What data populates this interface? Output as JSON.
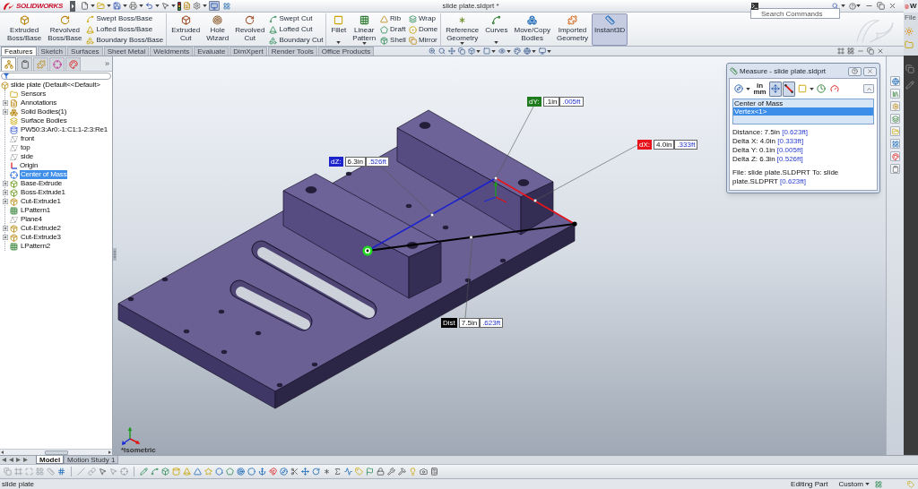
{
  "title_bar": {
    "logo": "SOLIDWORKS",
    "title": "slide plate.sldprt *",
    "search": {
      "placeholder": "Search Commands"
    },
    "quick_access_toggles": [
      {
        "on": true
      },
      {
        "on": false
      }
    ]
  },
  "ribbon": {
    "sections": [
      [
        {
          "kind": "large",
          "label": "Extruded Boss/Base",
          "on": false,
          "dropdown": false
        },
        {
          "kind": "large",
          "label": "Revolved Boss/Base",
          "on": false,
          "dropdown": false
        },
        {
          "kind": "stack",
          "items": [
            "Swept Boss/Base",
            "Lofted Boss/Base",
            "Boundary Boss/Base"
          ]
        }
      ],
      [
        {
          "kind": "large",
          "label": "Extruded Cut",
          "on": false,
          "dropdown": false
        },
        {
          "kind": "large",
          "label": "Hole Wizard",
          "on": false,
          "dropdown": false
        },
        {
          "kind": "large",
          "label": "Revolved Cut",
          "on": false,
          "dropdown": false
        },
        {
          "kind": "stack",
          "items": [
            "Swept Cut",
            "Lofted Cut",
            "Boundary Cut"
          ]
        }
      ],
      [
        {
          "kind": "large",
          "label": "Fillet",
          "on": false,
          "dropdown": true
        },
        {
          "kind": "large",
          "label": "Linear Pattern",
          "on": false,
          "dropdown": true
        },
        {
          "kind": "stack",
          "items": [
            "Rib",
            "Draft",
            "Shell"
          ]
        },
        {
          "kind": "stack",
          "items": [
            "Wrap",
            "Dome",
            "Mirror"
          ]
        }
      ],
      [
        {
          "kind": "large",
          "label": "Reference Geometry",
          "on": false,
          "dropdown": true
        },
        {
          "kind": "large",
          "label": "Curves",
          "on": false,
          "dropdown": true
        },
        {
          "kind": "large",
          "label": "Move/Copy Bodies",
          "on": false,
          "dropdown": false
        },
        {
          "kind": "large",
          "label": "Imported Geometry",
          "on": false,
          "dropdown": false
        },
        {
          "kind": "large",
          "label": "Instant3D",
          "on": true,
          "dropdown": false
        }
      ]
    ]
  },
  "tabs": [
    {
      "label": "Features",
      "selected": true
    },
    {
      "label": "Sketch",
      "selected": false
    },
    {
      "label": "Surfaces",
      "selected": false
    },
    {
      "label": "Sheet Metal",
      "selected": false
    },
    {
      "label": "Weldments",
      "selected": false
    },
    {
      "label": "Evaluate",
      "selected": false
    },
    {
      "label": "DimXpert",
      "selected": false
    },
    {
      "label": "Render Tools",
      "selected": false
    },
    {
      "label": "Office Products",
      "selected": false
    }
  ],
  "feature_tree": {
    "panel_tabs": [
      {
        "kind": "features",
        "selected": true
      },
      {
        "kind": "properties",
        "selected": false
      },
      {
        "kind": "configurations",
        "selected": false
      },
      {
        "kind": "dimxpert",
        "selected": false
      },
      {
        "kind": "display",
        "selected": false
      }
    ],
    "more": "»",
    "root": {
      "kind": "part",
      "label": "slide plate (Default<<Default>",
      "children": [
        {
          "kind": "sensors",
          "label": "Sensors",
          "expandable": false,
          "selected": false
        },
        {
          "kind": "annotations",
          "label": "Annotations",
          "expandable": true,
          "selected": false
        },
        {
          "kind": "solid-bodies",
          "label": "Solid Bodies(1)",
          "expandable": true,
          "selected": false
        },
        {
          "kind": "surface-bodies",
          "label": "Surface Bodies",
          "expandable": false,
          "selected": false
        },
        {
          "kind": "material",
          "label": "PW50:3:Ar0:-1:C1:1-2:3:Re1",
          "expandable": false,
          "selected": false
        },
        {
          "kind": "plane",
          "label": "front",
          "expandable": false,
          "selected": false
        },
        {
          "kind": "plane",
          "label": "top",
          "expandable": false,
          "selected": false
        },
        {
          "kind": "plane",
          "label": "side",
          "expandable": false,
          "selected": false
        },
        {
          "kind": "origin",
          "label": "Origin",
          "expandable": false,
          "selected": false
        },
        {
          "kind": "center-of-mass",
          "label": "Center of Mass",
          "expandable": false,
          "selected": true
        },
        {
          "kind": "boss",
          "label": "Base-Extrude",
          "expandable": true,
          "selected": false
        },
        {
          "kind": "boss",
          "label": "Boss-Extrude1",
          "expandable": true,
          "selected": false
        },
        {
          "kind": "cut",
          "label": "Cut-Extrude1",
          "expandable": true,
          "selected": false
        },
        {
          "kind": "pattern",
          "label": "LPattern1",
          "expandable": false,
          "selected": false
        },
        {
          "kind": "plane",
          "label": "Plane4",
          "expandable": false,
          "selected": false
        },
        {
          "kind": "cut",
          "label": "Cut-Extrude2",
          "expandable": true,
          "selected": false
        },
        {
          "kind": "cut",
          "label": "Cut-Extrude3",
          "expandable": true,
          "selected": false
        },
        {
          "kind": "pattern",
          "label": "LPattern2",
          "expandable": false,
          "selected": false
        }
      ]
    }
  },
  "viewport": {
    "view_label": "*Isometric",
    "callouts": [
      {
        "kind": "dy",
        "tag": "dY:",
        "value": ".1in",
        "alt": ".005ft",
        "color": "#1e7b1e"
      },
      {
        "kind": "dx",
        "tag": "dX:",
        "value": "4.0in",
        "alt": ".333ft",
        "color": "#e8141c"
      },
      {
        "kind": "dz",
        "tag": "dZ:",
        "value": "6.3in",
        "alt": ".526ft",
        "color": "#1c22cc"
      },
      {
        "kind": "dist",
        "tag": "Dist",
        "value": "7.5in",
        "alt": ".623ft",
        "color": "#000000"
      }
    ]
  },
  "measure": {
    "title": "Measure - slide plate.sldprt",
    "tools": [
      {
        "kind": "arc",
        "pressed": false,
        "dropdown": true
      },
      {
        "kind": "units",
        "label": "in mm",
        "pressed": false,
        "dropdown": false
      },
      {
        "kind": "xyz",
        "pressed": true,
        "dropdown": false
      },
      {
        "kind": "point-to-point",
        "pressed": true,
        "dropdown": false
      },
      {
        "kind": "projection",
        "pressed": false,
        "dropdown": true
      },
      {
        "kind": "history",
        "pressed": false,
        "dropdown": false
      },
      {
        "kind": "sensor",
        "pressed": false,
        "dropdown": false
      }
    ],
    "selections": [
      {
        "label": "Center of Mass",
        "selected": false
      },
      {
        "label": "Vertex<1>",
        "selected": true
      }
    ],
    "results": [
      {
        "text": "Distance: 7.5in",
        "alt": "[0.623ft]"
      },
      {
        "text": "Delta X: 4.0in",
        "alt": "[0.333ft]"
      },
      {
        "text": "Delta Y: 0.1in",
        "alt": "[0.005ft]"
      },
      {
        "text": "Delta Z: 6.3in",
        "alt": "[0.526ft]"
      }
    ],
    "file_line": {
      "text": "File: slide plate.SLDPRT To: slide plate.SLDPRT",
      "alt": "[0.623ft]"
    }
  },
  "bottom_tabs": [
    {
      "label": "Model",
      "selected": true
    },
    {
      "label": "Motion Study 1",
      "selected": false
    }
  ],
  "status_bar": {
    "document": "slide plate",
    "mode": "Editing Part",
    "units": "Custom"
  },
  "side_window": {
    "title": "W",
    "menu": "File"
  }
}
